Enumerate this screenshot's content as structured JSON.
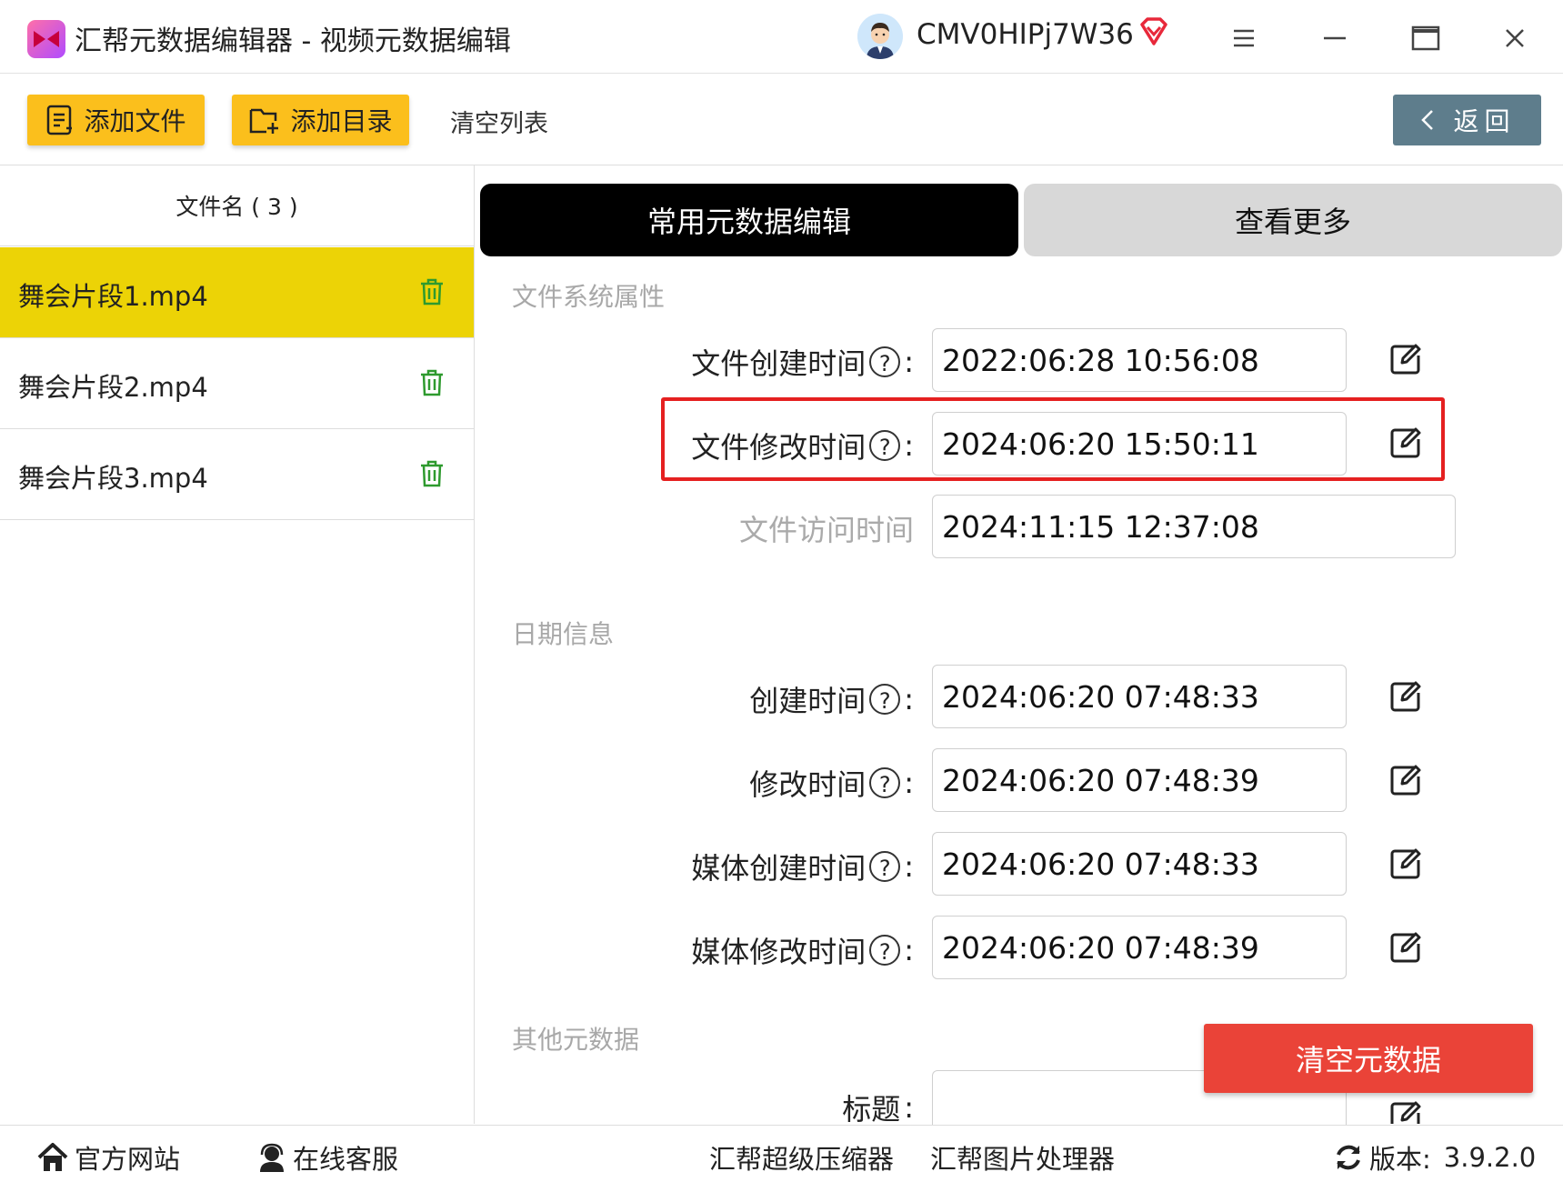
{
  "app": {
    "title": "汇帮元数据编辑器 - 视频元数据编辑",
    "username": "CMV0HIPj7W36"
  },
  "toolbar": {
    "add_file": "添加文件",
    "add_dir": "添加目录",
    "clear_list": "清空列表",
    "back": "返回"
  },
  "file_list": {
    "header": "文件名 ( 3 )",
    "items": [
      {
        "name": "舞会片段1.mp4",
        "selected": true
      },
      {
        "name": "舞会片段2.mp4",
        "selected": false
      },
      {
        "name": "舞会片段3.mp4",
        "selected": false
      }
    ]
  },
  "tabs": {
    "common": "常用元数据编辑",
    "more": "查看更多"
  },
  "sections": {
    "fs": {
      "title": "文件系统属性",
      "fields": [
        {
          "label": "文件创建时间",
          "value": "2022:06:28 10:56:08"
        },
        {
          "label": "文件修改时间",
          "value": "2024:06:20 15:50:11"
        },
        {
          "label": "文件访问时间",
          "value": "2024:11:15 12:37:08"
        }
      ]
    },
    "date": {
      "title": "日期信息",
      "fields": [
        {
          "label": "创建时间",
          "value": "2024:06:20 07:48:33"
        },
        {
          "label": "修改时间",
          "value": "2024:06:20 07:48:39"
        },
        {
          "label": "媒体创建时间",
          "value": "2024:06:20 07:48:33"
        },
        {
          "label": "媒体修改时间",
          "value": "2024:06:20 07:48:39"
        }
      ]
    },
    "other": {
      "title": "其他元数据",
      "fields": [
        {
          "label": "标题",
          "value": ""
        }
      ]
    }
  },
  "help_glyph": "?",
  "colon": ":",
  "clear_metadata": "清空元数据",
  "footer": {
    "website": "官方网站",
    "support": "在线客服",
    "compressor": "汇帮超级压缩器",
    "image_processor": "汇帮图片处理器",
    "version_label": "版本:",
    "version_value": "3.9.2.0"
  },
  "colors": {
    "accent_yellow": "#fbbf1c",
    "selected_row": "#ecd306",
    "danger": "#ea4338",
    "back_button": "#5e7d8c",
    "trash_green": "#2e9a2e"
  }
}
